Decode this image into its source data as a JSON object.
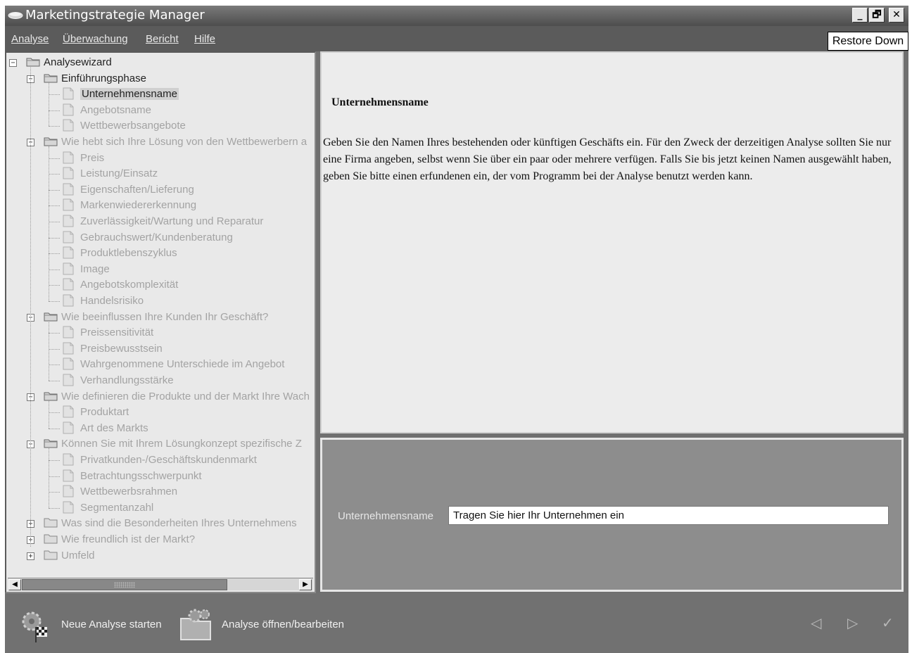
{
  "window": {
    "title": "Marketingstrategie Manager",
    "min_label": "_",
    "max_label": "🗗",
    "close_label": "✕",
    "tooltip": "Restore Down"
  },
  "menu": [
    {
      "label": "Analyse"
    },
    {
      "label": "Überwachung"
    },
    {
      "label": "Bericht"
    },
    {
      "label": "Hilfe"
    }
  ],
  "tree": {
    "root": "Analysewizard",
    "groups": [
      {
        "label": "Einführungsphase",
        "active": true,
        "expanded": true,
        "items": [
          "Unternehmensname",
          "Angebotsname",
          "Wettbewerbsangebote"
        ]
      },
      {
        "label": "Wie hebt sich Ihre Lösung von den Wettbewerbern a",
        "expanded": true,
        "items": [
          "Preis",
          "Leistung/Einsatz",
          "Eigenschaften/Lieferung",
          "Markenwiedererkennung",
          "Zuverlässigkeit/Wartung und Reparatur",
          "Gebrauchswert/Kundenberatung",
          "Produktlebenszyklus",
          "Image",
          "Angebotskomplexität",
          "Handelsrisiko"
        ]
      },
      {
        "label": "Wie beeinflussen Ihre Kunden Ihr Geschäft?",
        "expanded": true,
        "items": [
          "Preissensitivität",
          "Preisbewusstsein",
          "Wahrgenommene Unterschiede im Angebot",
          "Verhandlungsstärke"
        ]
      },
      {
        "label": "Wie definieren die Produkte und der Markt Ihre Wach",
        "expanded": true,
        "items": [
          "Produktart",
          "Art des Markts"
        ]
      },
      {
        "label": "Können Sie mit Ihrem Lösungkonzept spezifische Z",
        "expanded": true,
        "items": [
          "Privatkunden-/Geschäftskundenmarkt",
          "Betrachtungsschwerpunkt",
          "Wettbewerbsrahmen",
          "Segmentanzahl"
        ]
      },
      {
        "label": "Was sind die Besonderheiten Ihres Unternehmens",
        "expanded": false,
        "items": []
      },
      {
        "label": "Wie freundlich ist der Markt?",
        "expanded": false,
        "items": []
      },
      {
        "label": "Umfeld",
        "expanded": false,
        "items": []
      }
    ]
  },
  "description": {
    "heading": "Unternehmensname",
    "body": "Geben Sie den Namen Ihres bestehenden oder künftigen Geschäfts ein. Für den Zweck der derzeitigen Analyse sollten Sie nur eine Firma angeben, selbst wenn Sie über ein paar oder mehrere verfügen. Falls Sie bis jetzt keinen Namen ausgewählt haben, geben Sie bitte einen erfundenen ein, der vom Programm bei der Analyse benutzt werden kann."
  },
  "input": {
    "label": "Unternehmensname",
    "value": "Tragen Sie hier Ihr Unternehmen ein"
  },
  "bottom": {
    "new_analysis": "Neue Analyse starten",
    "open_analysis": "Analyse öffnen/bearbeiten"
  }
}
